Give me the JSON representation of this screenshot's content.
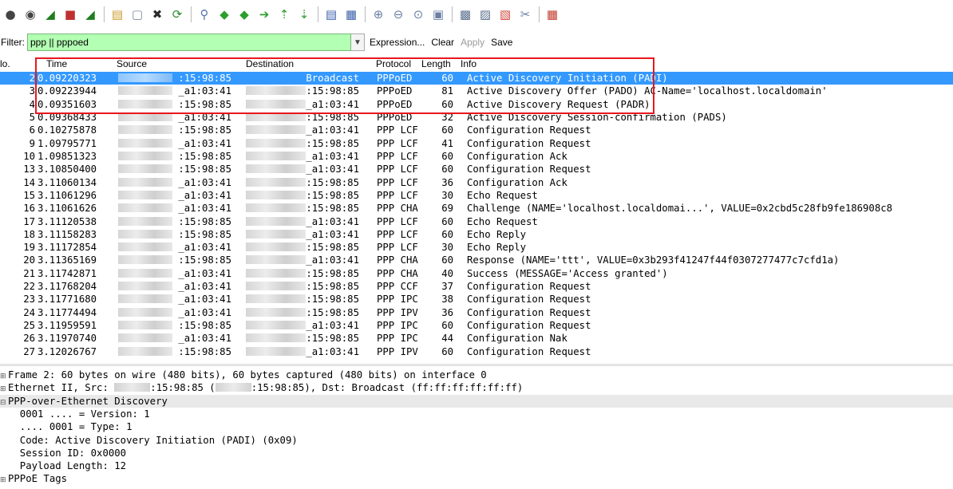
{
  "toolbar": {
    "icons": [
      "circle-icon",
      "circle-dot-icon",
      "shark-fin-icon",
      "stop-icon",
      "shark-fin-restart-icon",
      "sep",
      "folder-icon",
      "file-icon",
      "close-file-icon",
      "reload-icon",
      "sep",
      "search-icon",
      "back-arrow-icon",
      "forward-arrow-icon",
      "goto-icon",
      "top-icon",
      "bottom-icon",
      "sep",
      "colorize-icon",
      "autoscroll-icon",
      "sep",
      "zoom-in-icon",
      "zoom-out-icon",
      "zoom-normal-icon",
      "resize-columns-icon",
      "sep",
      "capture-filter-icon",
      "display-filter-icon",
      "coloring-rules-icon",
      "preferences-icon",
      "sep",
      "help-icon"
    ],
    "glyphs": [
      "●",
      "◉",
      "◢",
      "■",
      "◢",
      "",
      "▤",
      "▢",
      "✖",
      "⟳",
      "",
      "⚲",
      "◆",
      "◆",
      "➔",
      "⇡",
      "⇣",
      "",
      "▤",
      "▦",
      "",
      "⊕",
      "⊖",
      "⊙",
      "▣",
      "",
      "▩",
      "▨",
      "▧",
      "✂",
      "",
      "▦"
    ],
    "colors": [
      "#444",
      "#444",
      "#1e7d1e",
      "#c03030",
      "#1e7d1e",
      "",
      "#c99a2a",
      "#7a8aa0",
      "#2a2a2a",
      "#2e8a2e",
      "",
      "#5577aa",
      "#2d9e2d",
      "#2d9e2d",
      "#2d9e2d",
      "#2d9e2d",
      "#2d9e2d",
      "",
      "#3b5ea8",
      "#3b5ea8",
      "",
      "#6a7fa4",
      "#6a7fa4",
      "#6a7fa4",
      "#6a7fa4",
      "",
      "#5a6d8c",
      "#5a6d8c",
      "#d0473a",
      "#6a7fa4",
      "",
      "#c0392b"
    ]
  },
  "filter": {
    "label": "Filter:",
    "value": "ppp || pppoed",
    "expression": "Expression...",
    "clear": "Clear",
    "apply": "Apply",
    "save": "Save"
  },
  "packet_list": {
    "columns": [
      "lo.",
      "Time",
      "Source",
      "Destination",
      "Protocol",
      "Length",
      "Info"
    ],
    "rows": [
      {
        "no": "2",
        "time": "0.09220323",
        "src": ":15:98:85",
        "dst": "Broadcast",
        "proto": "PPPoED",
        "len": "60",
        "info": "Active Discovery Initiation (PADI)",
        "selected": true,
        "src_blur": true,
        "dst_blur": false
      },
      {
        "no": "3",
        "time": "0.09223944",
        "src": "_a1:03:41",
        "dst": ":15:98:85",
        "proto": "PPPoED",
        "len": "81",
        "info": "Active Discovery Offer (PADO) AC-Name='localhost.localdomain'",
        "selected": false,
        "src_blur": true,
        "dst_blur": true
      },
      {
        "no": "4",
        "time": "0.09351603",
        "src": ":15:98:85",
        "dst": "_a1:03:41",
        "proto": "PPPoED",
        "len": "60",
        "info": "Active Discovery Request (PADR)",
        "selected": false,
        "src_blur": true,
        "dst_blur": true
      },
      {
        "no": "5",
        "time": "0.09368433",
        "src": "_a1:03:41",
        "dst": ":15:98:85",
        "proto": "PPPoED",
        "len": "32",
        "info": "Active Discovery Session-confirmation (PADS)",
        "selected": false,
        "src_blur": true,
        "dst_blur": true
      },
      {
        "no": "6",
        "time": "0.10275878",
        "src": ":15:98:85",
        "dst": "_a1:03:41",
        "proto": "PPP LCF",
        "len": "60",
        "info": "Configuration Request",
        "selected": false,
        "src_blur": true,
        "dst_blur": true
      },
      {
        "no": "9",
        "time": "1.09795771",
        "src": "_a1:03:41",
        "dst": ":15:98:85",
        "proto": "PPP LCF",
        "len": "41",
        "info": "Configuration Request",
        "selected": false,
        "src_blur": true,
        "dst_blur": true
      },
      {
        "no": "10",
        "time": "1.09851323",
        "src": ":15:98:85",
        "dst": "_a1:03:41",
        "proto": "PPP LCF",
        "len": "60",
        "info": "Configuration Ack",
        "selected": false,
        "src_blur": true,
        "dst_blur": true
      },
      {
        "no": "13",
        "time": "3.10850400",
        "src": ":15:98:85",
        "dst": "_a1:03:41",
        "proto": "PPP LCF",
        "len": "60",
        "info": "Configuration Request",
        "selected": false,
        "src_blur": true,
        "dst_blur": true
      },
      {
        "no": "14",
        "time": "3.11060134",
        "src": "_a1:03:41",
        "dst": ":15:98:85",
        "proto": "PPP LCF",
        "len": "36",
        "info": "Configuration Ack",
        "selected": false,
        "src_blur": true,
        "dst_blur": true
      },
      {
        "no": "15",
        "time": "3.11061296",
        "src": "_a1:03:41",
        "dst": ":15:98:85",
        "proto": "PPP LCF",
        "len": "30",
        "info": "Echo Request",
        "selected": false,
        "src_blur": true,
        "dst_blur": true
      },
      {
        "no": "16",
        "time": "3.11061626",
        "src": "_a1:03:41",
        "dst": ":15:98:85",
        "proto": "PPP CHA",
        "len": "69",
        "info": "Challenge (NAME='localhost.localdomai...', VALUE=0x2cbd5c28fb9fe186908c8",
        "selected": false,
        "src_blur": true,
        "dst_blur": true
      },
      {
        "no": "17",
        "time": "3.11120538",
        "src": ":15:98:85",
        "dst": "_a1:03:41",
        "proto": "PPP LCF",
        "len": "60",
        "info": "Echo Request",
        "selected": false,
        "src_blur": true,
        "dst_blur": true
      },
      {
        "no": "18",
        "time": "3.11158283",
        "src": ":15:98:85",
        "dst": "_a1:03:41",
        "proto": "PPP LCF",
        "len": "60",
        "info": "Echo Reply",
        "selected": false,
        "src_blur": true,
        "dst_blur": true
      },
      {
        "no": "19",
        "time": "3.11172854",
        "src": "_a1:03:41",
        "dst": ":15:98:85",
        "proto": "PPP LCF",
        "len": "30",
        "info": "Echo Reply",
        "selected": false,
        "src_blur": true,
        "dst_blur": true
      },
      {
        "no": "20",
        "time": "3.11365169",
        "src": ":15:98:85",
        "dst": "_a1:03:41",
        "proto": "PPP CHA",
        "len": "60",
        "info": "Response (NAME='ttt', VALUE=0x3b293f41247f44f0307277477c7cfd1a)",
        "selected": false,
        "src_blur": true,
        "dst_blur": true
      },
      {
        "no": "21",
        "time": "3.11742871",
        "src": "_a1:03:41",
        "dst": ":15:98:85",
        "proto": "PPP CHA",
        "len": "40",
        "info": "Success (MESSAGE='Access granted')",
        "selected": false,
        "src_blur": true,
        "dst_blur": true
      },
      {
        "no": "22",
        "time": "3.11768204",
        "src": "_a1:03:41",
        "dst": ":15:98:85",
        "proto": "PPP CCF",
        "len": "37",
        "info": "Configuration Request",
        "selected": false,
        "src_blur": true,
        "dst_blur": true
      },
      {
        "no": "23",
        "time": "3.11771680",
        "src": "_a1:03:41",
        "dst": ":15:98:85",
        "proto": "PPP IPC",
        "len": "38",
        "info": "Configuration Request",
        "selected": false,
        "src_blur": true,
        "dst_blur": true
      },
      {
        "no": "24",
        "time": "3.11774494",
        "src": "_a1:03:41",
        "dst": ":15:98:85",
        "proto": "PPP IPV",
        "len": "36",
        "info": "Configuration Request",
        "selected": false,
        "src_blur": true,
        "dst_blur": true
      },
      {
        "no": "25",
        "time": "3.11959591",
        "src": ":15:98:85",
        "dst": "_a1:03:41",
        "proto": "PPP IPC",
        "len": "60",
        "info": "Configuration Request",
        "selected": false,
        "src_blur": true,
        "dst_blur": true
      },
      {
        "no": "26",
        "time": "3.11970740",
        "src": "_a1:03:41",
        "dst": ":15:98:85",
        "proto": "PPP IPC",
        "len": "44",
        "info": "Configuration Nak",
        "selected": false,
        "src_blur": true,
        "dst_blur": true
      },
      {
        "no": "27",
        "time": "3.12026767",
        "src": ":15:98:85",
        "dst": "_a1:03:41",
        "proto": "PPP IPV",
        "len": "60",
        "info": "Configuration Request",
        "selected": false,
        "src_blur": true,
        "dst_blur": true
      }
    ]
  },
  "detail": {
    "lines": [
      {
        "exp": "⊞",
        "text": "Frame 2: 60 bytes on wire (480 bits), 60 bytes captured (480 bits) on interface 0",
        "blur_parts": [],
        "hl": false
      },
      {
        "exp": "⊞",
        "text": "Ethernet II, Src: ",
        "blur_after_1": true,
        "text2": ":15:98:85 (",
        "blur_after_2": true,
        "text3": ":15:98:85), Dst: Broadcast (ff:ff:ff:ff:ff:ff)",
        "hl": false
      },
      {
        "exp": "⊟",
        "text": "PPP-over-Ethernet Discovery",
        "hl": true
      },
      {
        "exp": "",
        "text": "  0001 .... = Version: 1",
        "hl": false
      },
      {
        "exp": "",
        "text": "  .... 0001 = Type: 1",
        "hl": false
      },
      {
        "exp": "",
        "text": "  Code: Active Discovery Initiation (PADI) (0x09)",
        "hl": false
      },
      {
        "exp": "",
        "text": "  Session ID: 0x0000",
        "hl": false
      },
      {
        "exp": "",
        "text": "  Payload Length: 12",
        "hl": false
      },
      {
        "exp": "⊞",
        "text": "PPPoE Tags",
        "hl": false
      }
    ]
  }
}
